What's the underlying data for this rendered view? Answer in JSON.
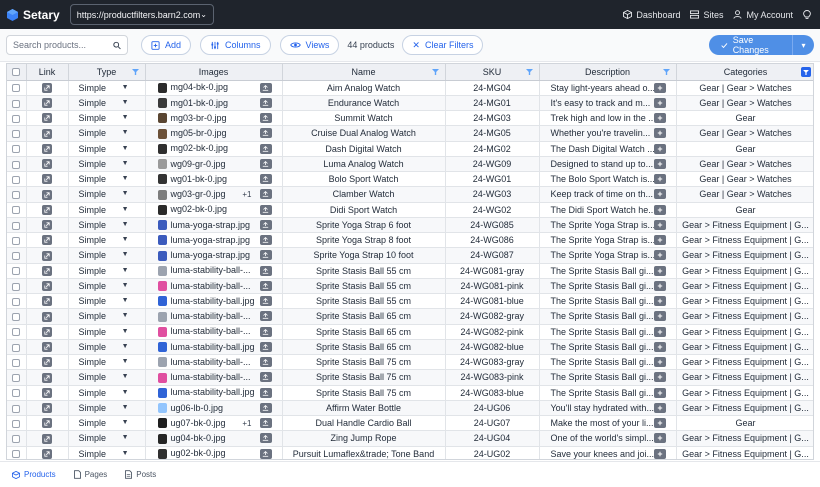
{
  "topbar": {
    "app_name": "Setary",
    "site_url": "https://productfilters.barn2.com",
    "nav": {
      "dashboard": "Dashboard",
      "sites": "Sites",
      "account": "My Account"
    }
  },
  "toolbar": {
    "search_placeholder": "Search products...",
    "add_label": "Add",
    "columns_label": "Columns",
    "views_label": "Views",
    "count_label": "44 products",
    "clear_filters_label": "Clear Filters",
    "save_label": "Save Changes"
  },
  "columns": [
    "Link",
    "Type",
    "Images",
    "Name",
    "SKU",
    "Description",
    "Categories"
  ],
  "rows": [
    {
      "type": "Simple",
      "image": "mg04-bk-0.jpg",
      "thumb": "#2b2b2b",
      "extra": "",
      "name": "Aim Analog Watch",
      "sku": "24-MG04",
      "desc": "Stay light-years ahead o...",
      "cat": "Gear | Gear > Watches"
    },
    {
      "type": "Simple",
      "image": "mg01-bk-0.jpg",
      "thumb": "#3a3a3a",
      "extra": "",
      "name": "Endurance Watch",
      "sku": "24-MG01",
      "desc": "It's easy to track and m...",
      "cat": "Gear | Gear > Watches"
    },
    {
      "type": "Simple",
      "image": "mg03-br-0.jpg",
      "thumb": "#5a4632",
      "extra": "",
      "name": "Summit Watch",
      "sku": "24-MG03",
      "desc": "Trek high and low in the ...",
      "cat": "Gear"
    },
    {
      "type": "Simple",
      "image": "mg05-br-0.jpg",
      "thumb": "#6b5038",
      "extra": "",
      "name": "Cruise Dual Analog Watch",
      "sku": "24-MG05",
      "desc": "Whether you're travelin...",
      "cat": "Gear | Gear > Watches"
    },
    {
      "type": "Simple",
      "image": "mg02-bk-0.jpg",
      "thumb": "#2f2f2f",
      "extra": "",
      "name": "Dash Digital Watch",
      "sku": "24-MG02",
      "desc": "The Dash Digital Watch ...",
      "cat": "Gear"
    },
    {
      "type": "Simple",
      "image": "wg09-gr-0.jpg",
      "thumb": "#9a9a9a",
      "extra": "",
      "name": "Luma Analog Watch",
      "sku": "24-WG09",
      "desc": "Designed to stand up to...",
      "cat": "Gear | Gear > Watches"
    },
    {
      "type": "Simple",
      "image": "wg01-bk-0.jpg",
      "thumb": "#333333",
      "extra": "",
      "name": "Bolo Sport Watch",
      "sku": "24-WG01",
      "desc": "The Bolo Sport Watch is...",
      "cat": "Gear | Gear > Watches"
    },
    {
      "type": "Simple",
      "image": "wg03-gr-0.jpg",
      "thumb": "#7d7d7d",
      "extra": "+1",
      "name": "Clamber Watch",
      "sku": "24-WG03",
      "desc": "Keep track of time on th...",
      "cat": "Gear | Gear > Watches"
    },
    {
      "type": "Simple",
      "image": "wg02-bk-0.jpg",
      "thumb": "#2a2a2a",
      "extra": "",
      "name": "Didi Sport Watch",
      "sku": "24-WG02",
      "desc": "The Didi Sport Watch he...",
      "cat": "Gear"
    },
    {
      "type": "Simple",
      "image": "luma-yoga-strap.jpg",
      "thumb": "#3b5bbd",
      "extra": "",
      "name": "Sprite Yoga Strap 6 foot",
      "sku": "24-WG085",
      "desc": "The Sprite Yoga Strap is...",
      "cat": "Gear > Fitness Equipment | G..."
    },
    {
      "type": "Simple",
      "image": "luma-yoga-strap.jpg",
      "thumb": "#3b5bbd",
      "extra": "",
      "name": "Sprite Yoga Strap 8 foot",
      "sku": "24-WG086",
      "desc": "The Sprite Yoga Strap is...",
      "cat": "Gear > Fitness Equipment | G..."
    },
    {
      "type": "Simple",
      "image": "luma-yoga-strap.jpg",
      "thumb": "#3b5bbd",
      "extra": "",
      "name": "Sprite Yoga Strap 10 foot",
      "sku": "24-WG087",
      "desc": "The Sprite Yoga Strap is...",
      "cat": "Gear > Fitness Equipment | G..."
    },
    {
      "type": "Simple",
      "image": "luma-stability-ball-...",
      "thumb": "#9ca3af",
      "extra": "",
      "name": "Sprite Stasis Ball 55 cm",
      "sku": "24-WG081-gray",
      "desc": "The Sprite Stasis Ball gi...",
      "cat": "Gear > Fitness Equipment | G..."
    },
    {
      "type": "Simple",
      "image": "luma-stability-ball-...",
      "thumb": "#e04fa0",
      "extra": "",
      "name": "Sprite Stasis Ball 55 cm",
      "sku": "24-WG081-pink",
      "desc": "The Sprite Stasis Ball gi...",
      "cat": "Gear > Fitness Equipment | G..."
    },
    {
      "type": "Simple",
      "image": "luma-stability-ball.jpg",
      "thumb": "#2f63d6",
      "extra": "",
      "name": "Sprite Stasis Ball 55 cm",
      "sku": "24-WG081-blue",
      "desc": "The Sprite Stasis Ball gi...",
      "cat": "Gear > Fitness Equipment | G..."
    },
    {
      "type": "Simple",
      "image": "luma-stability-ball-...",
      "thumb": "#9ca3af",
      "extra": "",
      "name": "Sprite Stasis Ball 65 cm",
      "sku": "24-WG082-gray",
      "desc": "The Sprite Stasis Ball gi...",
      "cat": "Gear > Fitness Equipment | G..."
    },
    {
      "type": "Simple",
      "image": "luma-stability-ball-...",
      "thumb": "#e04fa0",
      "extra": "",
      "name": "Sprite Stasis Ball 65 cm",
      "sku": "24-WG082-pink",
      "desc": "The Sprite Stasis Ball gi...",
      "cat": "Gear > Fitness Equipment | G..."
    },
    {
      "type": "Simple",
      "image": "luma-stability-ball.jpg",
      "thumb": "#2f63d6",
      "extra": "",
      "name": "Sprite Stasis Ball 65 cm",
      "sku": "24-WG082-blue",
      "desc": "The Sprite Stasis Ball gi...",
      "cat": "Gear > Fitness Equipment | G..."
    },
    {
      "type": "Simple",
      "image": "luma-stability-ball-...",
      "thumb": "#9ca3af",
      "extra": "",
      "name": "Sprite Stasis Ball 75 cm",
      "sku": "24-WG083-gray",
      "desc": "The Sprite Stasis Ball gi...",
      "cat": "Gear > Fitness Equipment | G..."
    },
    {
      "type": "Simple",
      "image": "luma-stability-ball-...",
      "thumb": "#e04fa0",
      "extra": "",
      "name": "Sprite Stasis Ball 75 cm",
      "sku": "24-WG083-pink",
      "desc": "The Sprite Stasis Ball gi...",
      "cat": "Gear > Fitness Equipment | G..."
    },
    {
      "type": "Simple",
      "image": "luma-stability-ball.jpg",
      "thumb": "#2f63d6",
      "extra": "",
      "name": "Sprite Stasis Ball 75 cm",
      "sku": "24-WG083-blue",
      "desc": "The Sprite Stasis Ball gi...",
      "cat": "Gear > Fitness Equipment | G..."
    },
    {
      "type": "Simple",
      "image": "ug06-lb-0.jpg",
      "thumb": "#93c5fd",
      "extra": "",
      "name": "Affirm Water Bottle",
      "sku": "24-UG06",
      "desc": "You'll stay hydrated with...",
      "cat": "Gear > Fitness Equipment | G..."
    },
    {
      "type": "Simple",
      "image": "ug07-bk-0.jpg",
      "thumb": "#1f1f1f",
      "extra": "+1",
      "name": "Dual Handle Cardio Ball",
      "sku": "24-UG07",
      "desc": "Make the most of your li...",
      "cat": "Gear"
    },
    {
      "type": "Simple",
      "image": "ug04-bk-0.jpg",
      "thumb": "#262626",
      "extra": "",
      "name": "Zing Jump Rope",
      "sku": "24-UG04",
      "desc": "One of the world's simpl...",
      "cat": "Gear > Fitness Equipment | G..."
    },
    {
      "type": "Simple",
      "image": "ug02-bk-0.jpg",
      "thumb": "#303030",
      "extra": "",
      "name": "Pursuit Lumaflex&trade; Tone Band",
      "sku": "24-UG02",
      "desc": "Save your knees and joi...",
      "cat": "Gear > Fitness Equipment | G..."
    }
  ],
  "bottom_tabs": [
    "Products",
    "Pages",
    "Posts"
  ],
  "colors": {
    "accent": "#2563eb",
    "topbar_bg": "#1f242c",
    "save_bg": "#4f8fe6"
  }
}
